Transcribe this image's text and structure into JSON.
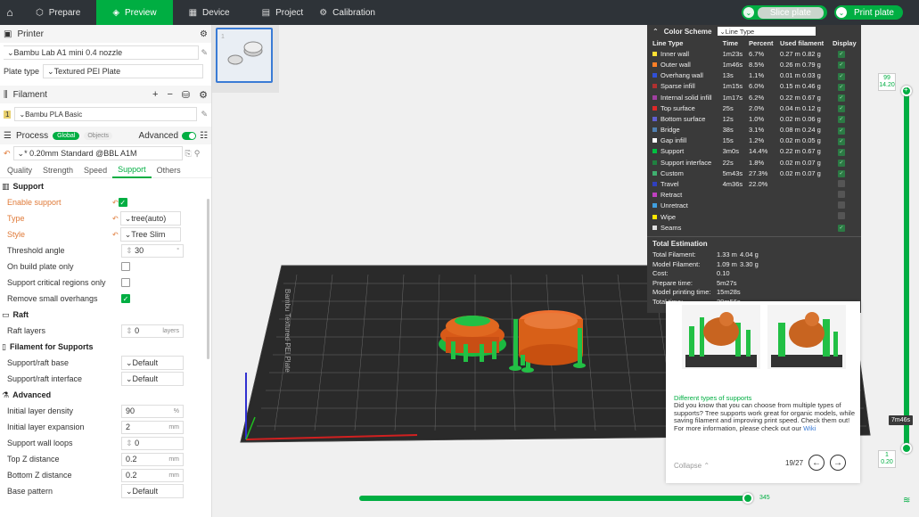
{
  "topbar": {
    "tabs": [
      {
        "label": "Prepare",
        "icon": "cube-icon"
      },
      {
        "label": "Preview",
        "icon": "preview-icon"
      },
      {
        "label": "Device",
        "icon": "device-icon"
      },
      {
        "label": "Project",
        "icon": "project-icon"
      },
      {
        "label": "Calibration",
        "icon": "calibration-icon"
      }
    ],
    "slice_label": "Slice plate",
    "print_label": "Print plate"
  },
  "printer": {
    "header": "Printer",
    "model": "Bambu Lab A1 mini 0.4 nozzle",
    "plate_type_label": "Plate type",
    "plate_type_value": "Textured PEI Plate"
  },
  "filament": {
    "header": "Filament",
    "index": "1",
    "value": "Bambu PLA Basic"
  },
  "process": {
    "header": "Process",
    "global_label": "Global",
    "objects_label": "Objects",
    "advanced_label": "Advanced",
    "profile": "* 0.20mm Standard @BBL A1M",
    "tabs": [
      "Quality",
      "Strength",
      "Speed",
      "Support",
      "Others"
    ]
  },
  "support": {
    "header": "Support",
    "enable_label": "Enable support",
    "type_label": "Type",
    "type_value": "tree(auto)",
    "style_label": "Style",
    "style_value": "Tree Slim",
    "threshold_label": "Threshold angle",
    "threshold_value": "30",
    "on_build_label": "On build plate only",
    "critical_label": "Support critical regions only",
    "remove_small_label": "Remove small overhangs"
  },
  "raft": {
    "header": "Raft",
    "layers_label": "Raft layers",
    "layers_value": "0",
    "layers_unit": "layers"
  },
  "filament_supports": {
    "header": "Filament for Supports",
    "base_label": "Support/raft base",
    "base_value": "Default",
    "interface_label": "Support/raft interface",
    "interface_value": "Default"
  },
  "advanced": {
    "header": "Advanced",
    "rows": [
      {
        "label": "Initial layer density",
        "value": "90",
        "unit": "%"
      },
      {
        "label": "Initial layer expansion",
        "value": "2",
        "unit": "mm"
      },
      {
        "label": "Support wall loops",
        "value": "0",
        "unit": ""
      },
      {
        "label": "Top Z distance",
        "value": "0.2",
        "unit": "mm"
      },
      {
        "label": "Bottom Z distance",
        "value": "0.2",
        "unit": "mm"
      },
      {
        "label": "Base pattern",
        "value": "Default",
        "unit": ""
      }
    ]
  },
  "color_scheme": {
    "title": "Color Scheme",
    "selected": "Line Type",
    "headers": [
      "Line Type",
      "Time",
      "Percent",
      "Used filament",
      "Display"
    ],
    "rows": [
      {
        "name": "Inner wall",
        "color": "#ffe033",
        "time": "1m23s",
        "pct": "6.7%",
        "len": "0.27 m",
        "g": "0.82 g",
        "on": true
      },
      {
        "name": "Outer wall",
        "color": "#ff7f27",
        "time": "1m46s",
        "pct": "8.5%",
        "len": "0.26 m",
        "g": "0.79 g",
        "on": true
      },
      {
        "name": "Overhang wall",
        "color": "#3050d8",
        "time": "13s",
        "pct": "1.1%",
        "len": "0.01 m",
        "g": "0.03 g",
        "on": true
      },
      {
        "name": "Sparse infill",
        "color": "#b03030",
        "time": "1m15s",
        "pct": "6.0%",
        "len": "0.15 m",
        "g": "0.46 g",
        "on": true
      },
      {
        "name": "Internal solid infill",
        "color": "#a040a0",
        "time": "1m17s",
        "pct": "6.2%",
        "len": "0.22 m",
        "g": "0.67 g",
        "on": true
      },
      {
        "name": "Top surface",
        "color": "#e02828",
        "time": "25s",
        "pct": "2.0%",
        "len": "0.04 m",
        "g": "0.12 g",
        "on": true
      },
      {
        "name": "Bottom surface",
        "color": "#6060d0",
        "time": "12s",
        "pct": "1.0%",
        "len": "0.02 m",
        "g": "0.06 g",
        "on": true
      },
      {
        "name": "Bridge",
        "color": "#5080b0",
        "time": "38s",
        "pct": "3.1%",
        "len": "0.08 m",
        "g": "0.24 g",
        "on": true
      },
      {
        "name": "Gap infill",
        "color": "#ffffff",
        "time": "15s",
        "pct": "1.2%",
        "len": "0.02 m",
        "g": "0.05 g",
        "on": true
      },
      {
        "name": "Support",
        "color": "#00c040",
        "time": "3m0s",
        "pct": "14.4%",
        "len": "0.22 m",
        "g": "0.67 g",
        "on": true
      },
      {
        "name": "Support interface",
        "color": "#208040",
        "time": "22s",
        "pct": "1.8%",
        "len": "0.02 m",
        "g": "0.07 g",
        "on": true
      },
      {
        "name": "Custom",
        "color": "#40b070",
        "time": "5m43s",
        "pct": "27.3%",
        "len": "0.02 m",
        "g": "0.07 g",
        "on": true
      },
      {
        "name": "Travel",
        "color": "#3040c0",
        "time": "4m36s",
        "pct": "22.0%",
        "len": "",
        "g": "",
        "on": false
      },
      {
        "name": "Retract",
        "color": "#c040c0",
        "time": "",
        "pct": "",
        "len": "",
        "g": "",
        "on": false
      },
      {
        "name": "Unretract",
        "color": "#40a0e0",
        "time": "",
        "pct": "",
        "len": "",
        "g": "",
        "on": false
      },
      {
        "name": "Wipe",
        "color": "#ffe800",
        "time": "",
        "pct": "",
        "len": "",
        "g": "",
        "on": false
      },
      {
        "name": "Seams",
        "color": "#e0e0e0",
        "time": "",
        "pct": "",
        "len": "",
        "g": "",
        "on": true
      }
    ]
  },
  "estimation": {
    "title": "Total Estimation",
    "rows": [
      {
        "k": "Total Filament:",
        "v1": "1.33 m",
        "v2": "4.04 g"
      },
      {
        "k": "Model Filament:",
        "v1": "1.09 m",
        "v2": "3.30 g"
      },
      {
        "k": "Cost:",
        "v1": "0.10",
        "v2": ""
      },
      {
        "k": "Prepare time:",
        "v1": "5m27s",
        "v2": ""
      },
      {
        "k": "Model printing time:",
        "v1": "15m28s",
        "v2": ""
      },
      {
        "k": "Total time:",
        "v1": "20m56s",
        "v2": ""
      }
    ]
  },
  "tip": {
    "title": "Different types of supports",
    "body": "Did you know that you can choose from multiple types of supports? Tree supports work great for organic models, while saving filament and improving print speed. Check them out!",
    "more": "For more information, please check out our",
    "link": "Wiki",
    "collapse": "Collapse",
    "page": "19/27"
  },
  "sliders": {
    "layer_top": "99",
    "height_top": "14.20",
    "layer_bottom": "1",
    "height_bottom": "0.20",
    "time_label": "7m46s",
    "move_value": "345"
  },
  "plate_text": "Bambu Textured PEI Plate"
}
